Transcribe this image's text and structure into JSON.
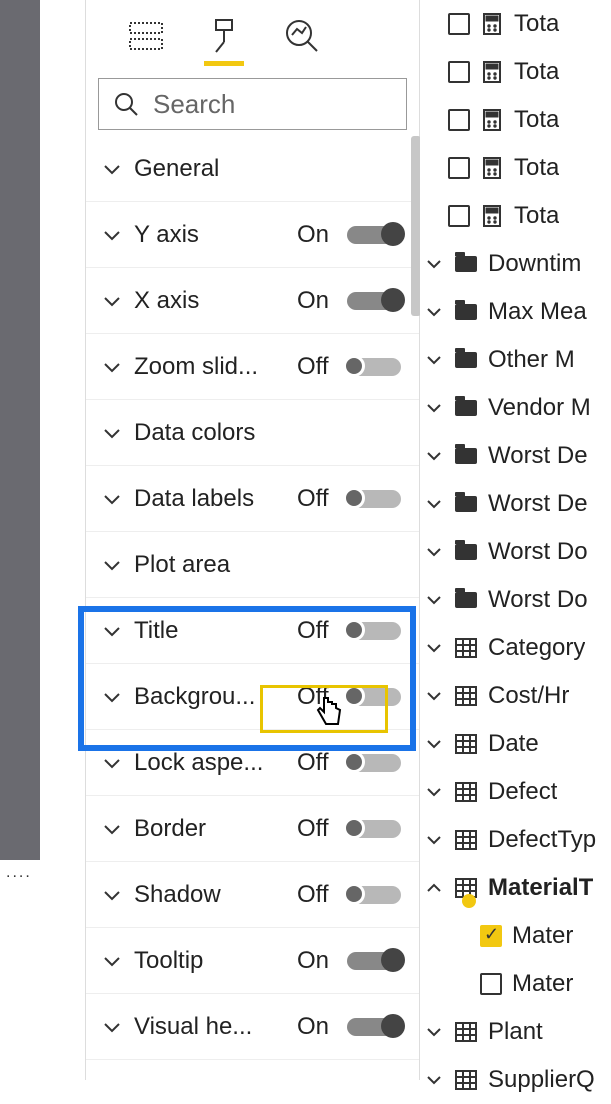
{
  "search": {
    "placeholder": "Search"
  },
  "format_rows": [
    {
      "label": "General",
      "toggle": null
    },
    {
      "label": "Y axis",
      "toggle": "On"
    },
    {
      "label": "X axis",
      "toggle": "On"
    },
    {
      "label": "Zoom slid...",
      "toggle": "Off"
    },
    {
      "label": "Data colors",
      "toggle": null
    },
    {
      "label": "Data labels",
      "toggle": "Off"
    },
    {
      "label": "Plot area",
      "toggle": null
    },
    {
      "label": "Title",
      "toggle": "Off"
    },
    {
      "label": "Backgrou...",
      "toggle": "Off"
    },
    {
      "label": "Lock aspe...",
      "toggle": "Off"
    },
    {
      "label": "Border",
      "toggle": "Off"
    },
    {
      "label": "Shadow",
      "toggle": "Off"
    },
    {
      "label": "Tooltip",
      "toggle": "On"
    },
    {
      "label": "Visual he...",
      "toggle": "On"
    }
  ],
  "fields_top": [
    "Tota",
    "Tota",
    "Tota",
    "Tota",
    "Tota"
  ],
  "folders": [
    "Downtim",
    "Max Mea",
    "Other M",
    "Vendor M",
    "Worst De",
    "Worst De",
    "Worst Do",
    "Worst Do"
  ],
  "tables": [
    {
      "label": "Category",
      "expanded": false
    },
    {
      "label": "Cost/Hr",
      "expanded": false
    },
    {
      "label": "Date",
      "expanded": false
    },
    {
      "label": "Defect",
      "expanded": false
    },
    {
      "label": "DefectTyp",
      "expanded": false
    },
    {
      "label": "MaterialT",
      "expanded": true,
      "selected": true,
      "children": [
        {
          "label": "Mater",
          "checked": true
        },
        {
          "label": "Mater",
          "checked": false
        }
      ]
    },
    {
      "label": "Plant",
      "expanded": false
    },
    {
      "label": "SupplierQ",
      "expanded": false
    }
  ]
}
